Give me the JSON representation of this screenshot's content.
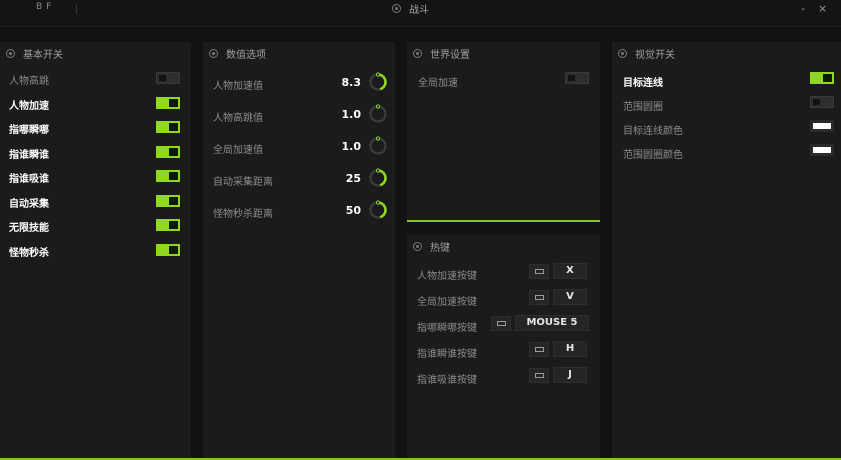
{
  "titlebar": {
    "left_text": "BF",
    "title": "战斗",
    "minimize": "-",
    "close": "×"
  },
  "basic": {
    "title": "基本开关",
    "items": [
      {
        "label": "人物高跳",
        "on": false
      },
      {
        "label": "人物加速",
        "on": true
      },
      {
        "label": "指哪瞬哪",
        "on": true
      },
      {
        "label": "指谁瞬谁",
        "on": true
      },
      {
        "label": "指谁吸谁",
        "on": true
      },
      {
        "label": "自动采集",
        "on": true
      },
      {
        "label": "无限技能",
        "on": true
      },
      {
        "label": "怪物秒杀",
        "on": true
      }
    ]
  },
  "values": {
    "title": "数值选项",
    "items": [
      {
        "label": "人物加速值",
        "value": "8.3",
        "fraction": 0.45
      },
      {
        "label": "人物高跳值",
        "value": "1.0",
        "fraction": 0.03
      },
      {
        "label": "全局加速值",
        "value": "1.0",
        "fraction": 0.03
      },
      {
        "label": "自动采集距离",
        "value": "25",
        "fraction": 0.45
      },
      {
        "label": "怪物秒杀距离",
        "value": "50",
        "fraction": 0.45
      }
    ]
  },
  "world": {
    "title": "世界设置",
    "items": [
      {
        "label": "全局加速",
        "on": false
      }
    ]
  },
  "hotkeys": {
    "title": "热键",
    "items": [
      {
        "label": "人物加速按键",
        "key": "X"
      },
      {
        "label": "全局加速按键",
        "key": "V"
      },
      {
        "label": "指哪瞬哪按键",
        "key": "MOUSE 5"
      },
      {
        "label": "指谁瞬谁按键",
        "key": "H"
      },
      {
        "label": "指谁吸谁按键",
        "key": "J"
      }
    ]
  },
  "visual": {
    "title": "视觉开关",
    "items": [
      {
        "label": "目标连线",
        "type": "toggle",
        "on": true
      },
      {
        "label": "范围圆圈",
        "type": "toggle",
        "on": false
      },
      {
        "label": "目标连线颜色",
        "type": "color",
        "color": "#ffffff"
      },
      {
        "label": "范围圆圈颜色",
        "type": "color",
        "color": "#ffffff"
      }
    ]
  },
  "colors": {
    "accent": "#8fd81e",
    "panel": "#1b1b1b",
    "background": "#121212"
  }
}
